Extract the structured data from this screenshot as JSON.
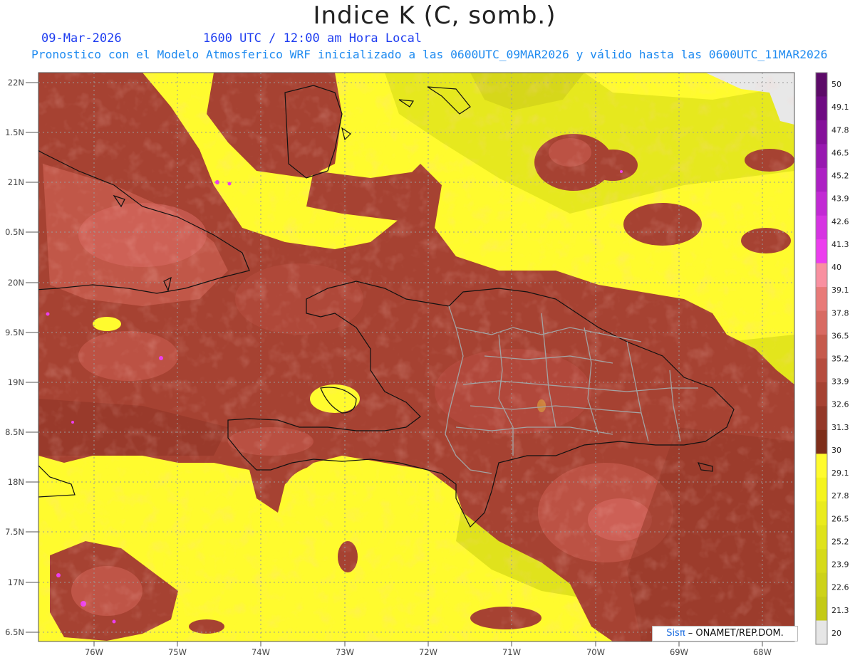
{
  "header": {
    "title": "Indice K (C, somb.)",
    "date": "09-Mar-2026",
    "time": "1600 UTC / 12:00 am Hora Local",
    "description": "Pronostico con el Modelo Atmosferico WRF inicializado a las 0600UTC_09MAR2026 y válido hasta las  0600UTC_11MAR2026"
  },
  "axes": {
    "lat_labels": [
      "22N",
      "1.5N",
      "21N",
      "0.5N",
      "20N",
      "9.5N",
      "19N",
      "8.5N",
      "18N",
      "7.5N",
      "17N",
      "6.5N"
    ],
    "lon_labels": [
      "76W",
      "75W",
      "74W",
      "73W",
      "72W",
      "71W",
      "70W",
      "69W",
      "68W"
    ]
  },
  "colorbar": {
    "labels": [
      "50",
      "49.1",
      "47.8",
      "46.5",
      "45.2",
      "43.9",
      "42.6",
      "41.3",
      "40",
      "39.1",
      "37.8",
      "36.5",
      "35.2",
      "33.9",
      "32.6",
      "31.3",
      "30",
      "29.1",
      "27.8",
      "26.5",
      "25.2",
      "23.9",
      "22.6",
      "21.3",
      "20"
    ],
    "colors": [
      "#5c0a68",
      "#6e0a82",
      "#85109a",
      "#9818b0",
      "#ad20c4",
      "#c22ad4",
      "#d634e2",
      "#ec3eee",
      "#f990a0",
      "#e87a78",
      "#d86a62",
      "#c65a4c",
      "#b64c3e",
      "#a64232",
      "#943828",
      "#7e2e1a",
      "#fffb2e",
      "#f5f41c",
      "#eaeb1c",
      "#dfe21a",
      "#d6da18",
      "#cdd218",
      "#c4ca16",
      "#e6e6e6"
    ]
  },
  "credit": {
    "brand": "Sisπ",
    "separator": " – ",
    "org": "ONAMET/REP.DOM."
  }
}
